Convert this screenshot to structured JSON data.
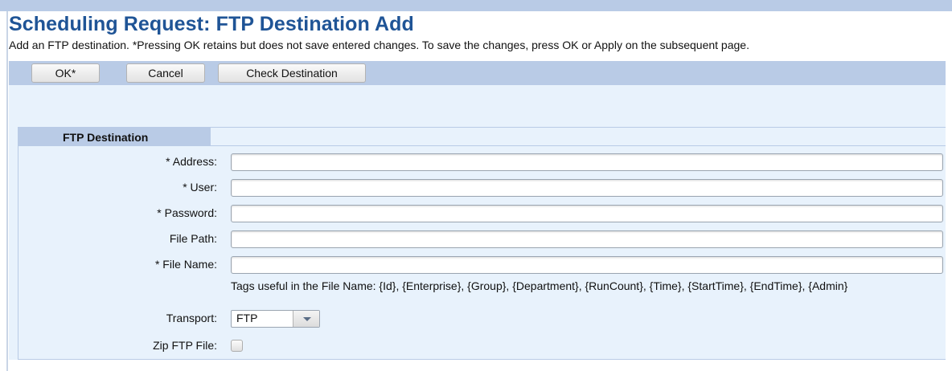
{
  "header": {
    "title": "Scheduling Request: FTP Destination Add",
    "description": "Add an FTP destination. *Pressing OK retains but does not save entered changes. To save the changes, press OK or Apply on the subsequent page."
  },
  "toolbar": {
    "ok_label": "OK*",
    "cancel_label": "Cancel",
    "check_destination_label": "Check Destination"
  },
  "section": {
    "title": "FTP Destination"
  },
  "form": {
    "address": {
      "label": "* Address:",
      "value": ""
    },
    "user": {
      "label": "* User:",
      "value": ""
    },
    "password": {
      "label": "* Password:",
      "value": ""
    },
    "file_path": {
      "label": "File Path:",
      "value": ""
    },
    "file_name": {
      "label": "* File Name:",
      "value": "",
      "hint": "Tags useful in the File Name:  {Id}, {Enterprise}, {Group}, {Department}, {RunCount}, {Time}, {StartTime}, {EndTime}, {Admin}"
    },
    "transport": {
      "label": "Transport:",
      "selected": "FTP"
    },
    "zip_ftp_file": {
      "label": "Zip FTP File:",
      "checked": false
    }
  },
  "colors": {
    "title": "#1f5496",
    "toolbar_bg": "#b9cbe6",
    "panel_bg": "#e8f2fc"
  },
  "icons": {
    "transport_dropdown": "chevron-down-icon"
  }
}
